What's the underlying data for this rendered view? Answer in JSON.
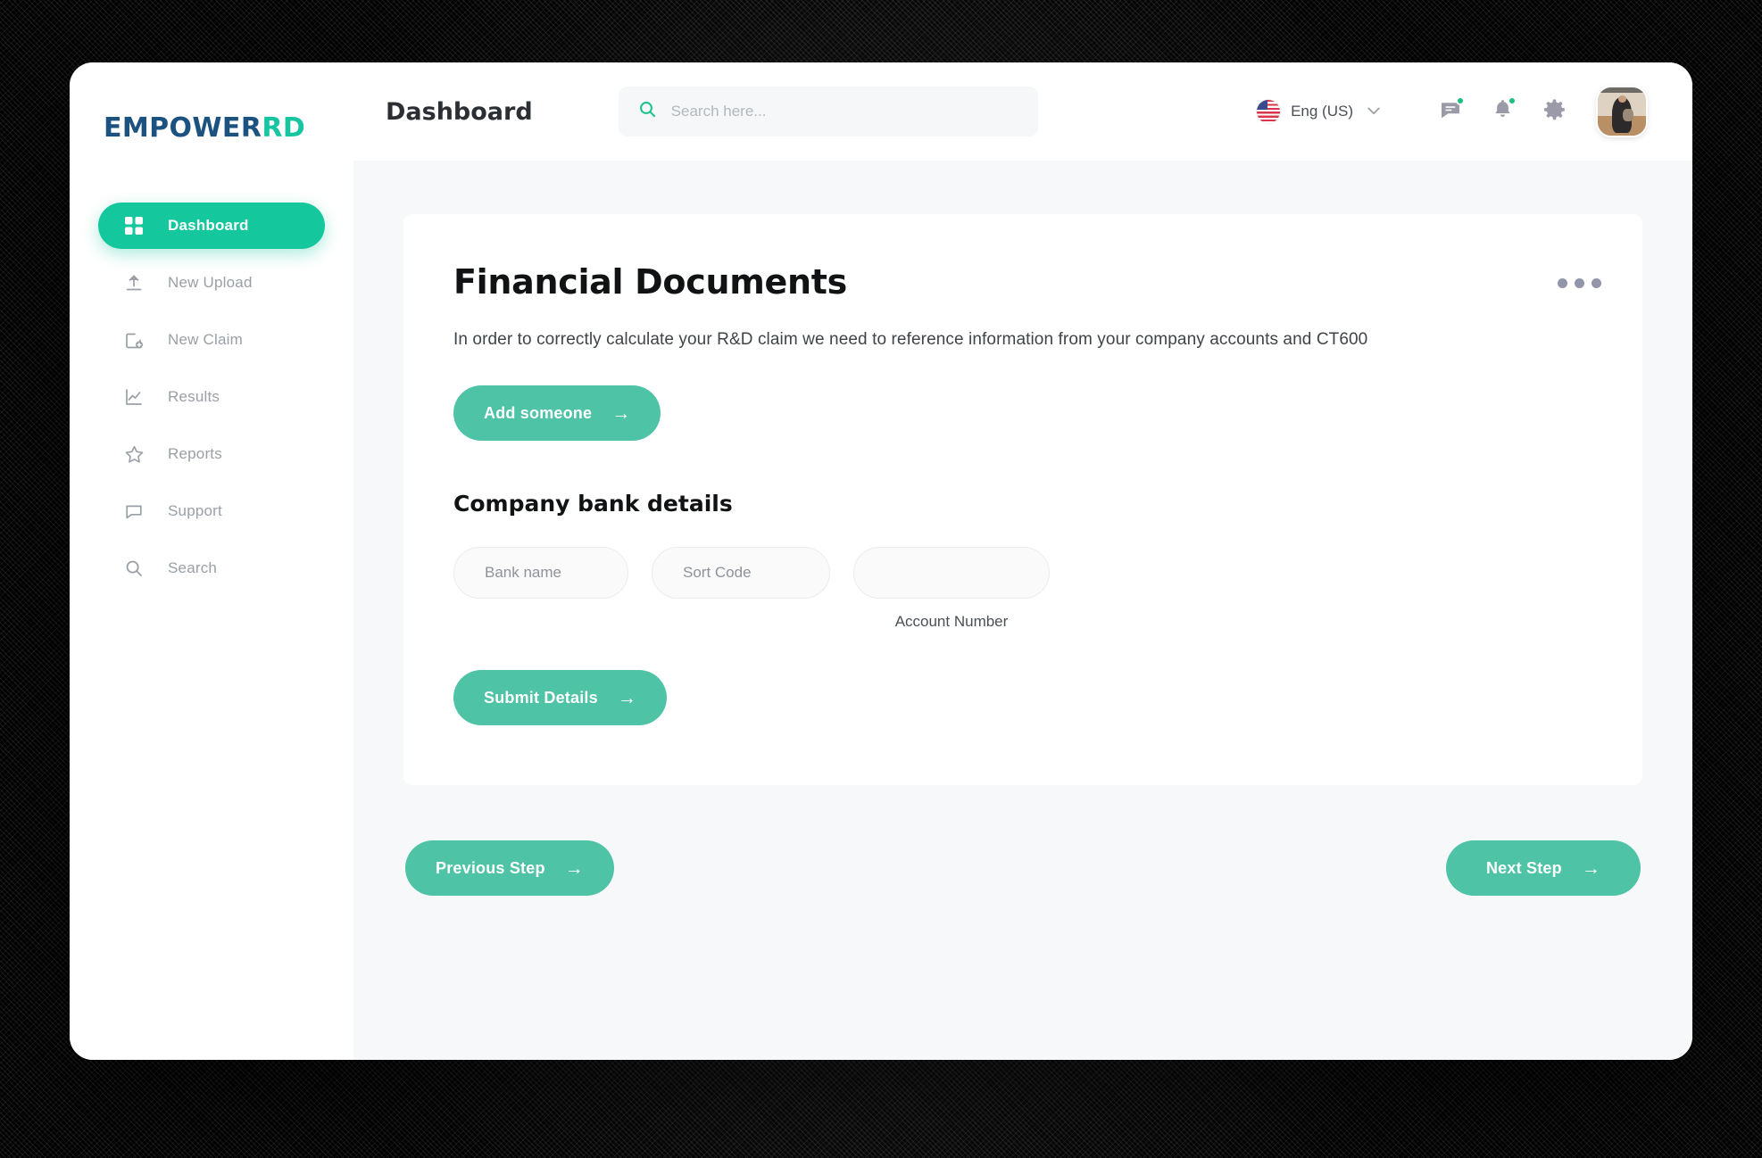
{
  "brand": {
    "logo_primary": "EMPOWER",
    "logo_accent": "RD",
    "accent_color": "#15c79c",
    "logo_primary_color": "#1c5280"
  },
  "sidebar": {
    "items": [
      {
        "label": "Dashboard",
        "icon": "grid-icon",
        "active": true
      },
      {
        "label": "New Upload",
        "icon": "upload-icon",
        "active": false
      },
      {
        "label": "New Claim",
        "icon": "new-claim-icon",
        "active": false
      },
      {
        "label": "Results",
        "icon": "chart-line-icon",
        "active": false
      },
      {
        "label": "Reports",
        "icon": "star-icon",
        "active": false
      },
      {
        "label": "Support",
        "icon": "chat-bubble-icon",
        "active": false
      },
      {
        "label": "Search",
        "icon": "search-icon",
        "active": false
      }
    ]
  },
  "header": {
    "title": "Dashboard",
    "search": {
      "value": "",
      "placeholder": "Search here..."
    },
    "language": {
      "label": "Eng (US)",
      "flag": "us-flag-icon",
      "chevron": "chevron-down-icon"
    },
    "messages_icon": "messages-icon",
    "messages_has_badge": true,
    "notifications_icon": "bell-icon",
    "notifications_has_badge": true,
    "settings_icon": "gear-icon",
    "avatar": "user-avatar",
    "badge_color": "#17c17f"
  },
  "card": {
    "title": "Financial Documents",
    "description": "In order to correctly calculate your R&D claim we need to reference information from your company accounts and CT600",
    "menu_icon": "more-options-icon",
    "add_someone_label": "Add someone",
    "bank_section_heading": "Company bank details",
    "bank_fields": [
      {
        "name": "bank-name",
        "value": "",
        "placeholder": "Bank name",
        "caption": ""
      },
      {
        "name": "sort-code",
        "value": "",
        "placeholder": "Sort Code",
        "caption": ""
      },
      {
        "name": "account-number",
        "value": "",
        "placeholder": "",
        "caption": "Account Number"
      }
    ],
    "submit_label": "Submit Details",
    "button_color": "#4ec3a6",
    "arrow_glyph": "→"
  },
  "step_nav": {
    "previous_label": "Previous Step",
    "next_label": "Next Step"
  }
}
